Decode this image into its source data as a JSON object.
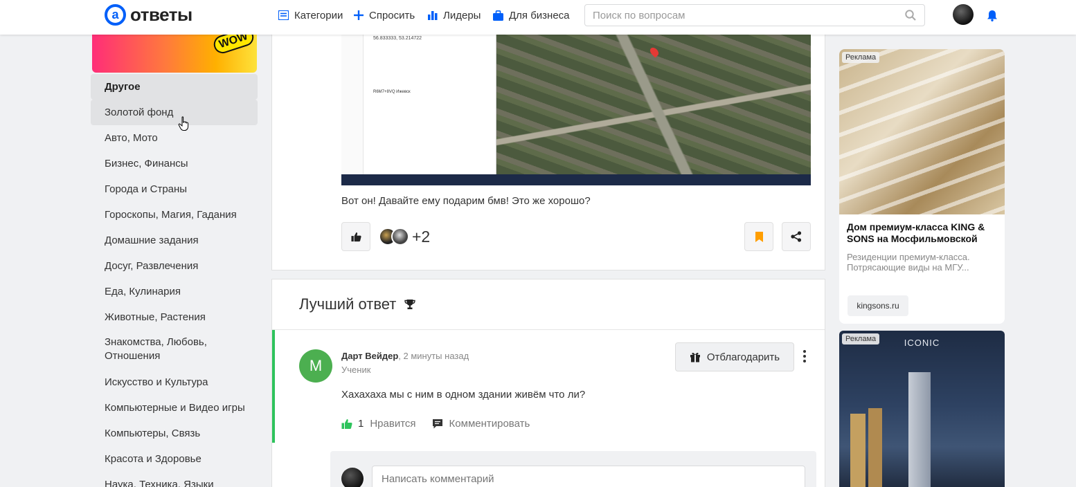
{
  "header": {
    "logo_text": "ответы",
    "nav": [
      {
        "label": "Категории",
        "icon": "list-icon"
      },
      {
        "label": "Спросить",
        "icon": "plus-icon"
      },
      {
        "label": "Лидеры",
        "icon": "bar-chart-icon"
      },
      {
        "label": "Для бизнеса",
        "icon": "briefcase-icon"
      }
    ],
    "search_placeholder": "Поиск по вопросам"
  },
  "sidebar": {
    "promo_badge": "WOW",
    "categories": [
      "Другое",
      "Золотой фонд",
      "Авто, Мото",
      "Бизнес, Финансы",
      "Города и Страны",
      "Гороскопы, Магия, Гадания",
      "Домашние задания",
      "Досуг, Развлечения",
      "Еда, Кулинария",
      "Животные, Растения",
      "Знакомства, Любовь, Отношения",
      "Искусство и Культура",
      "Компьютерные и Видео игры",
      "Компьютеры, Связь",
      "Красота и Здоровье",
      "Наука, Техника, Языки"
    ]
  },
  "question": {
    "map_coords": "56.833333, 53.214722",
    "map_address": "R6M7+8VQ Ижевск",
    "text": "Вот он! Давайте ему подарим бмв! Это же хорошо?",
    "likes_more": "+2"
  },
  "best_answer": {
    "title": "Лучший ответ",
    "avatar_letter": "М",
    "author": "Дарт Вейдер",
    "time": ", 2 минуты назад",
    "rank": "Ученик",
    "thank_label": "Отблагодарить",
    "text": "Хахахаха мы с ним в одном здании живём что ли?",
    "like_count": "1",
    "like_label": "Нравится",
    "comment_label": "Комментировать",
    "comment_placeholder": "Написать комментарий"
  },
  "ads": {
    "label": "Реклама",
    "ad1_title": "Дом премиум-класса KING & SONS на Мосфильмовской",
    "ad1_desc": "Резиденции премиум-класса. Потрясающие виды на МГУ...",
    "ad1_domain": "kingsons.ru",
    "ad2_brand": "ICONIC"
  },
  "colors": {
    "accent": "#005ff9",
    "success": "#2ec35c",
    "bookmark": "#ff9e00"
  }
}
